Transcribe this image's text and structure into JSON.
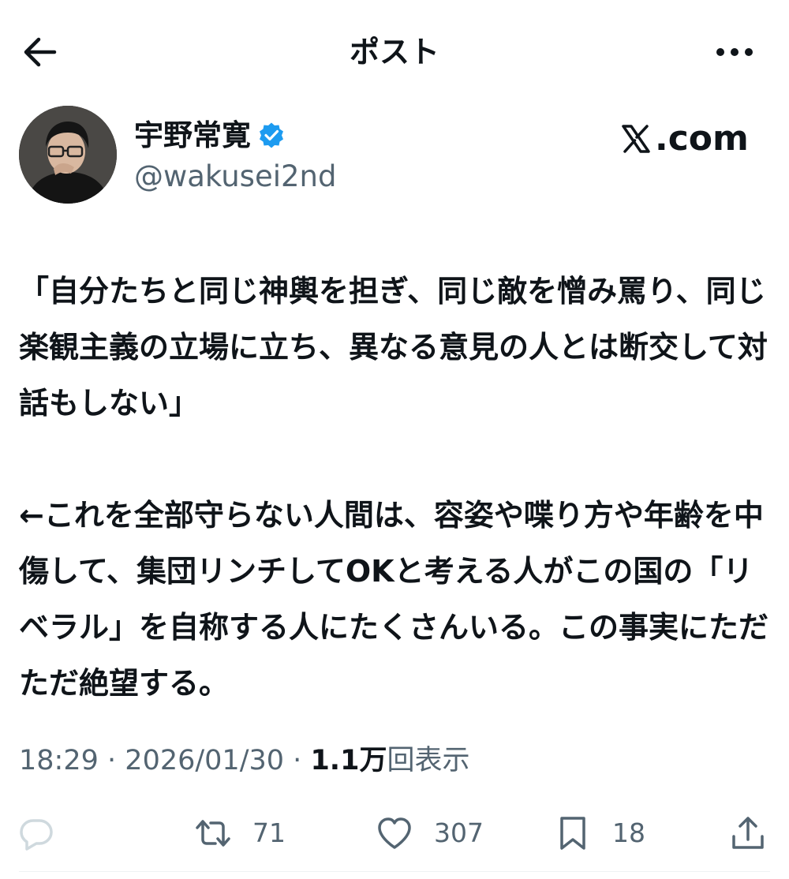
{
  "header": {
    "title": "ポスト"
  },
  "author": {
    "display_name": "宇野常寛",
    "handle": "@wakusei2nd",
    "verified": true
  },
  "watermark": {
    "text": ".com"
  },
  "post": {
    "text": "「自分たちと同じ神輿を担ぎ、同じ敵を憎み罵り、同じ楽観主義の立場に立ち、異なる意見の人とは断交して対話もしない」\n\n←これを全部守らない人間は、容姿や喋り方や年齢を中傷して、集団リンチしてOKと考える人がこの国の「リベラル」を自称する人にたくさんいる。この事実にただただ絶望する。",
    "time": "18:29",
    "separator": "·",
    "date": "2026/01/30",
    "views_count": "1.1万",
    "views_label": "回表示"
  },
  "actions": {
    "reply_count": "",
    "repost_count": "71",
    "like_count": "307",
    "bookmark_count": "18"
  },
  "colors": {
    "text": "#0f1419",
    "secondary": "#536471",
    "verified_blue": "#1d9bf0",
    "divider": "#eff3f4"
  },
  "icons": {
    "back": "arrow-left-icon",
    "more": "more-horizontal-icon",
    "verified": "verified-badge-icon",
    "reply": "reply-bubble-icon",
    "repost": "repost-icon",
    "like": "heart-icon",
    "bookmark": "bookmark-icon",
    "share": "share-icon"
  }
}
